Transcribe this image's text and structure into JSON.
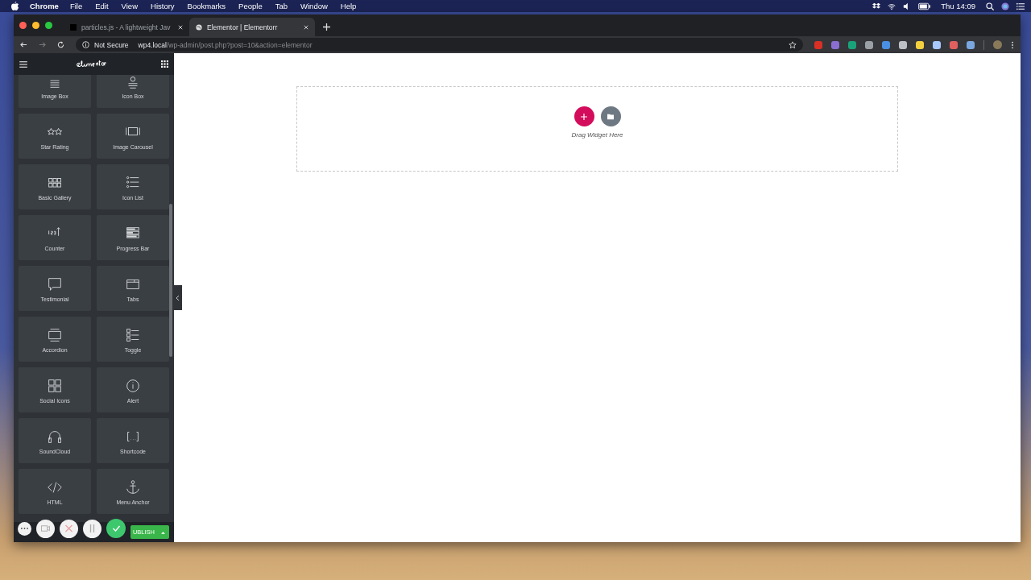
{
  "menu_bar": {
    "app": "Chrome",
    "items": [
      "File",
      "Edit",
      "View",
      "History",
      "Bookmarks",
      "People",
      "Tab",
      "Window",
      "Help"
    ],
    "clock": "Thu 14:09"
  },
  "tabs": [
    {
      "title": "particles.js - A lightweight Jav",
      "selected": false
    },
    {
      "title": "Elementor | Elementorr",
      "selected": true
    }
  ],
  "address_bar": {
    "security": "Not Secure",
    "host": "wp4.local",
    "path": "/wp-admin/post.php?post=10&action=elementor"
  },
  "widgets": [
    {
      "label": "Image Box",
      "kind": "imagebox"
    },
    {
      "label": "Icon Box",
      "kind": "iconbox"
    },
    {
      "label": "Star Rating",
      "kind": "stars"
    },
    {
      "label": "Image Carousel",
      "kind": "carousel"
    },
    {
      "label": "Basic Gallery",
      "kind": "gallery"
    },
    {
      "label": "Icon List",
      "kind": "list"
    },
    {
      "label": "Counter",
      "kind": "counter"
    },
    {
      "label": "Progress Bar",
      "kind": "progress"
    },
    {
      "label": "Testimonial",
      "kind": "testimonial"
    },
    {
      "label": "Tabs",
      "kind": "tabs"
    },
    {
      "label": "Accordion",
      "kind": "accordion"
    },
    {
      "label": "Toggle",
      "kind": "toggle"
    },
    {
      "label": "Social Icons",
      "kind": "social"
    },
    {
      "label": "Alert",
      "kind": "alert"
    },
    {
      "label": "SoundCloud",
      "kind": "headphones"
    },
    {
      "label": "Shortcode",
      "kind": "shortcode"
    },
    {
      "label": "HTML",
      "kind": "html"
    },
    {
      "label": "Menu Anchor",
      "kind": "anchor"
    }
  ],
  "publish_button": "UBLISH",
  "canvas": {
    "hint": "Drag Widget Here"
  }
}
